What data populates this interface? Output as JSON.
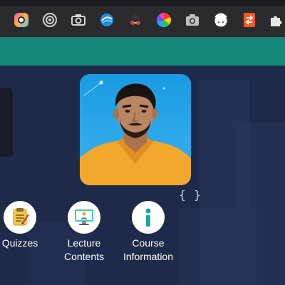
{
  "toolbar": {
    "extensions": [
      {
        "icon": "color-picker-icon"
      },
      {
        "icon": "screen-recorder-icon"
      },
      {
        "icon": "camera-icon"
      },
      {
        "icon": "vpn-icon"
      },
      {
        "icon": "spy-icon"
      },
      {
        "icon": "color-wheel-icon"
      },
      {
        "icon": "screenshot-icon"
      },
      {
        "icon": "json-icon"
      },
      {
        "icon": "orange-arrows-icon"
      },
      {
        "icon": "puzzle-icon"
      }
    ]
  },
  "profile": {
    "braces": "{ }"
  },
  "nav": {
    "items": [
      {
        "label": "Quizzes",
        "icon": "quiz-icon"
      },
      {
        "label": "Lecture\nContents",
        "icon": "lecture-icon"
      },
      {
        "label": "Course\nInformation",
        "icon": "info-icon"
      }
    ]
  },
  "colors": {
    "toolbar": "#2b2b2e",
    "header": "#17877a",
    "background": "#1f2a4a",
    "photo_bg": "#1ea3e6",
    "shirt": "#f2a72e"
  }
}
